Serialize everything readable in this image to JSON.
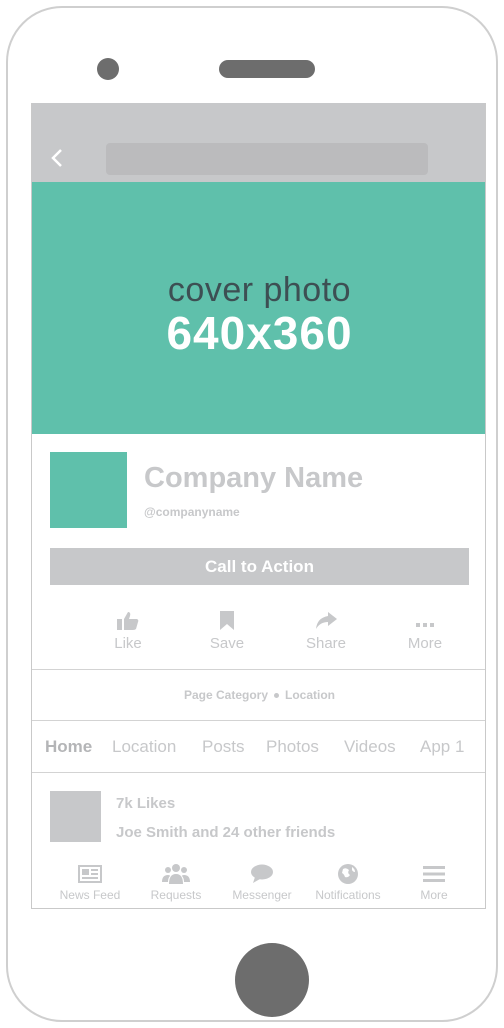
{
  "cover": {
    "line1": "cover photo",
    "line2": "640x360"
  },
  "profile": {
    "name": "Company Name",
    "handle": "@companyname"
  },
  "cta_label": "Call to Action",
  "actions": [
    {
      "label": "Like",
      "icon": "thumbs-up-icon"
    },
    {
      "label": "Save",
      "icon": "bookmark-icon"
    },
    {
      "label": "Share",
      "icon": "share-arrow-icon"
    },
    {
      "label": "More",
      "icon": "more-dots-icon"
    }
  ],
  "meta": {
    "category": "Page Category",
    "location": "Location"
  },
  "tabs": [
    "Home",
    "Location",
    "Posts",
    "Photos",
    "Videos",
    "App 1"
  ],
  "likes": {
    "count": "7k Likes",
    "friends": "Joe Smith and 24 other friends"
  },
  "bottom_nav": [
    {
      "label": "News Feed",
      "icon": "newspaper-icon"
    },
    {
      "label": "Requests",
      "icon": "people-icon"
    },
    {
      "label": "Messenger",
      "icon": "chat-bubble-icon"
    },
    {
      "label": "Notifications",
      "icon": "globe-icon"
    },
    {
      "label": "More",
      "icon": "hamburger-menu-icon"
    }
  ],
  "colors": {
    "accent": "#5fc0ab",
    "placeholder": "#c7c8ca",
    "device": "#6d6d6d"
  }
}
